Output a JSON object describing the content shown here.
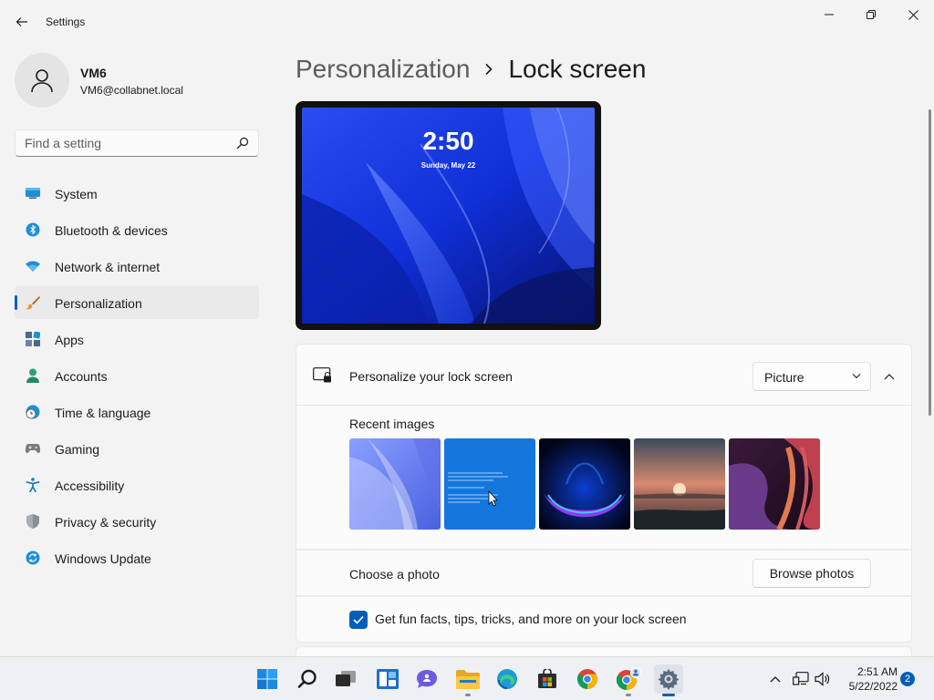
{
  "window": {
    "title": "Settings"
  },
  "profile": {
    "name": "VM6",
    "email": "VM6@collabnet.local"
  },
  "search": {
    "placeholder": "Find a setting"
  },
  "sidebar": {
    "items": [
      {
        "label": "System",
        "icon": "system-icon"
      },
      {
        "label": "Bluetooth & devices",
        "icon": "bluetooth-icon"
      },
      {
        "label": "Network & internet",
        "icon": "wifi-icon"
      },
      {
        "label": "Personalization",
        "icon": "paintbrush-icon",
        "active": true
      },
      {
        "label": "Apps",
        "icon": "apps-icon"
      },
      {
        "label": "Accounts",
        "icon": "accounts-icon"
      },
      {
        "label": "Time & language",
        "icon": "clock-globe-icon"
      },
      {
        "label": "Gaming",
        "icon": "gamepad-icon"
      },
      {
        "label": "Accessibility",
        "icon": "accessibility-icon"
      },
      {
        "label": "Privacy & security",
        "icon": "shield-icon"
      },
      {
        "label": "Windows Update",
        "icon": "update-icon"
      }
    ]
  },
  "breadcrumb": {
    "parent": "Personalization",
    "current": "Lock screen"
  },
  "preview": {
    "time": "2:50",
    "date": "Sunday, May 22"
  },
  "lock_screen": {
    "personalize_label": "Personalize your lock screen",
    "personalize_value": "Picture",
    "recent_images_label": "Recent images",
    "recent_images": [
      "blue-bloom-light",
      "blue-screen-text",
      "dark-bloom",
      "sunset-lake",
      "purple-ribbon"
    ],
    "choose_photo_label": "Choose a photo",
    "browse_button": "Browse photos",
    "fun_facts_label": "Get fun facts, tips, tricks, and more on your lock screen",
    "fun_facts_checked": true
  },
  "taskbar": {
    "apps": [
      "start-icon",
      "search-icon",
      "task-view-icon",
      "widgets-icon",
      "chat-icon",
      "file-explorer-icon",
      "edge-icon",
      "store-icon",
      "chrome-icon",
      "chrome-profile-icon",
      "settings-icon"
    ],
    "time": "2:51 AM",
    "date": "5/22/2022",
    "notification_count": "2"
  },
  "colors": {
    "accent": "#005fb8",
    "background": "#f3f3f3",
    "card": "#fbfbfb"
  }
}
